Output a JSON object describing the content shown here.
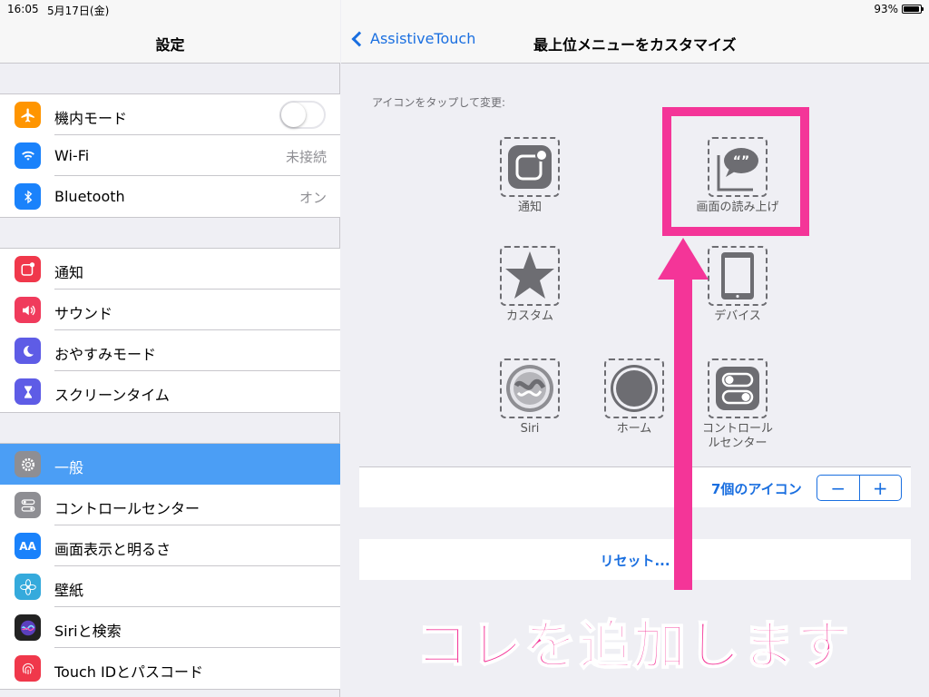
{
  "status_bar": {
    "time": "16:05",
    "date": "5月17日(金)",
    "battery": "93%"
  },
  "left_panel": {
    "title": "設定",
    "groups": [
      {
        "rows": [
          {
            "label": "機内モード",
            "icon": "airplane-icon",
            "color": "#ff9500",
            "type": "toggle"
          },
          {
            "label": "Wi-Fi",
            "icon": "wifi-icon",
            "color": "#1a82fb",
            "value": "未接続"
          },
          {
            "label": "Bluetooth",
            "icon": "bluetooth-icon",
            "color": "#1a82fb",
            "value": "オン"
          }
        ]
      },
      {
        "rows": [
          {
            "label": "通知",
            "icon": "notification-icon",
            "color": "#f0384b"
          },
          {
            "label": "サウンド",
            "icon": "speaker-icon",
            "color": "#f03b5c"
          },
          {
            "label": "おやすみモード",
            "icon": "moon-icon",
            "color": "#5e5ce6"
          },
          {
            "label": "スクリーンタイム",
            "icon": "hourglass-icon",
            "color": "#5e5ce6"
          }
        ]
      },
      {
        "rows": [
          {
            "label": "一般",
            "icon": "gear-icon",
            "color": "#8e8e93",
            "selected": true
          },
          {
            "label": "コントロールセンター",
            "icon": "control-center-icon",
            "color": "#8e8e93"
          },
          {
            "label": "画面表示と明るさ",
            "icon": "display-icon",
            "color": "#1a82fb"
          },
          {
            "label": "壁紙",
            "icon": "wallpaper-icon",
            "color": "#35aadc"
          },
          {
            "label": "Siriと検索",
            "icon": "siri-icon",
            "color": "#222"
          },
          {
            "label": "Touch IDとパスコード",
            "icon": "fingerprint-icon",
            "color": "#f0384b"
          }
        ]
      }
    ]
  },
  "right_panel": {
    "back_label": "AssistiveTouch",
    "title": "最上位メニューをカスタマイズ",
    "hint": "アイコンをタップして変更:",
    "tiles": [
      {
        "label": "通知",
        "icon": "notification-icon"
      },
      {
        "label": "画面の読み上げ",
        "icon": "speech-bubble-icon"
      },
      {
        "label": "カスタム",
        "icon": "star-icon"
      },
      {
        "label": "デバイス",
        "icon": "ipad-icon"
      },
      {
        "label": "Siri",
        "icon": "siri-icon"
      },
      {
        "label": "ホーム",
        "icon": "home-button-icon"
      },
      {
        "label": "コントロール",
        "label2": "ルセンター",
        "icon": "control-center-icon"
      }
    ],
    "count_label": "7個のアイコン",
    "minus": "−",
    "plus": "+",
    "reset_label": "リセット..."
  },
  "annotation": {
    "text": "コレを追加します",
    "color": "#f43598"
  }
}
